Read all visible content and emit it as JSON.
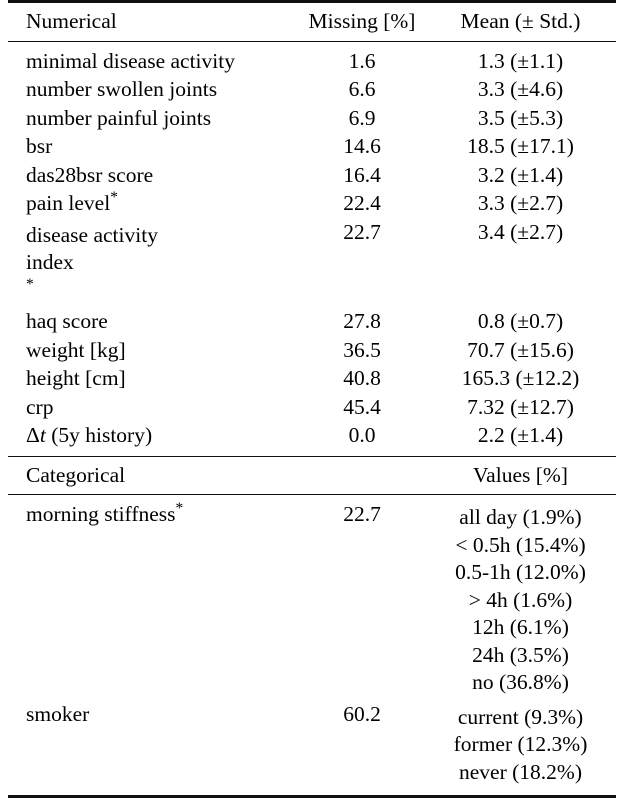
{
  "table": {
    "numerical": {
      "section_label": "Numerical",
      "col_missing": "Missing [%]",
      "col_mean": "Mean (± Std.)",
      "rows": [
        {
          "name": "minimal disease activity",
          "missing": "1.6",
          "mean": "1.3 (±1.1)"
        },
        {
          "name": "number swollen joints",
          "missing": "6.6",
          "mean": "3.3 (±4.6)"
        },
        {
          "name": "number painful joints",
          "missing": "6.9",
          "mean": "3.5 (±5.3)"
        },
        {
          "name": "bsr",
          "missing": "14.6",
          "mean": "18.5 (±17.1)"
        },
        {
          "name": "das28bsr score",
          "missing": "16.4",
          "mean": "3.2 (±1.4)"
        },
        {
          "name": "pain level",
          "starred": true,
          "missing": "22.4",
          "mean": "3.3 (±2.7)"
        },
        {
          "name_line1": "disease activity",
          "name_line2": "index",
          "starred": true,
          "missing": "22.7",
          "mean": "3.4 (±2.7)"
        },
        {
          "name": "haq score",
          "missing": "27.8",
          "mean": "0.8 (±0.7)"
        },
        {
          "name": "weight [kg]",
          "missing": "36.5",
          "mean": "70.7 (±15.6)"
        },
        {
          "name": "height [cm]",
          "missing": "40.8",
          "mean": "165.3 (±12.2)"
        },
        {
          "name": "crp",
          "missing": "45.4",
          "mean": "7.32 (±12.7)"
        },
        {
          "name_delta": "Δ",
          "name_var": "t",
          "name_rest": " (5y history)",
          "missing": "0.0",
          "mean": "2.2 (±1.4)"
        }
      ]
    },
    "categorical": {
      "section_label": "Categorical",
      "col_values": "Values [%]",
      "rows": [
        {
          "name": "morning stiffness",
          "starred": true,
          "missing": "22.7",
          "values": [
            "all day (1.9%)",
            "< 0.5h (15.4%)",
            "0.5-1h (12.0%)",
            "> 4h (1.6%)",
            "12h (6.1%)",
            "24h (3.5%)",
            "no (36.8%)"
          ]
        },
        {
          "name": "smoker",
          "starred": false,
          "missing": "60.2",
          "values": [
            "current (9.3%)",
            "former (12.3%)",
            "never (18.2%)"
          ]
        }
      ]
    }
  }
}
